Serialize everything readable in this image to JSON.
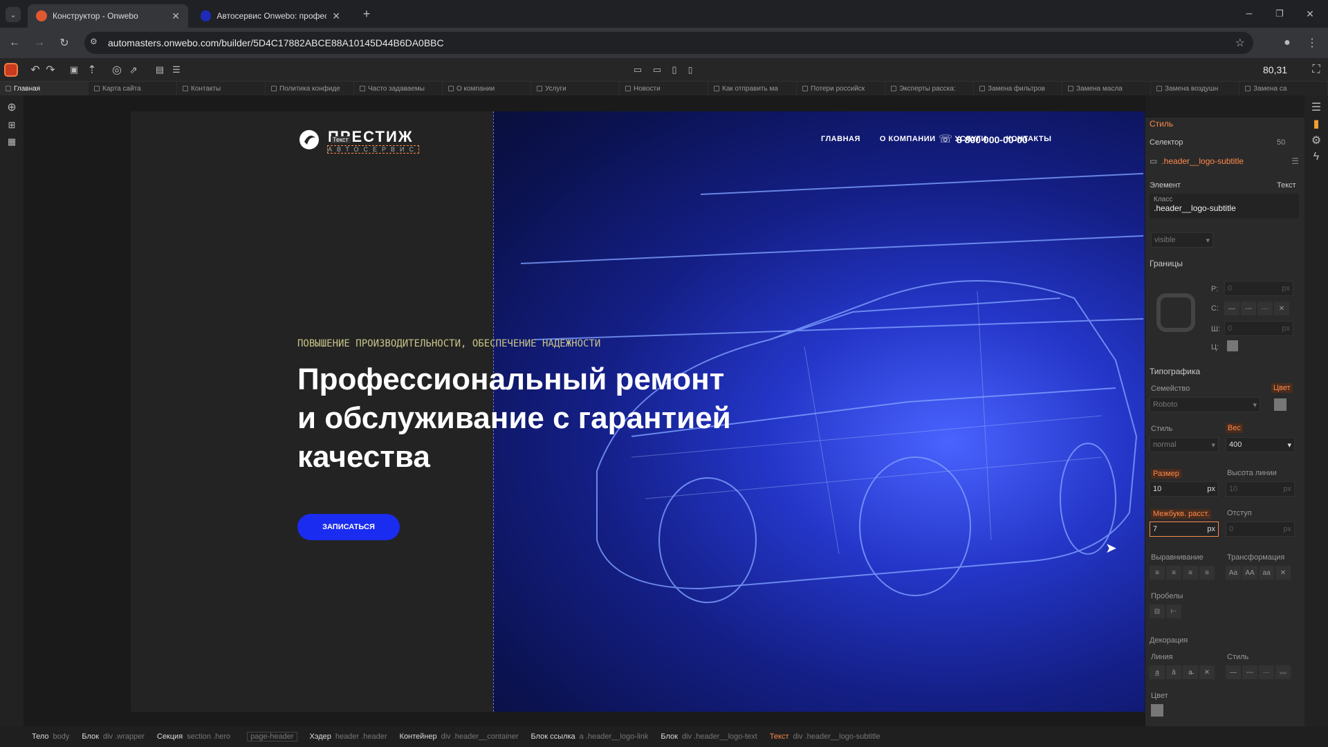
{
  "browser": {
    "tabs": [
      {
        "title": "Конструктор - Onwebo",
        "active": true
      },
      {
        "title": "Автосервис Onwebo: професс",
        "active": false
      }
    ],
    "url": "automasters.onwebo.com/builder/5D4C17882ABCE88A10145D44B6DA0BBC"
  },
  "editor": {
    "zoom": "80,31",
    "page_tabs": [
      "Главная",
      "Карта сайта",
      "Контакты",
      "Политика конфиде",
      "Часто задаваемы",
      "О компании",
      "Услуги",
      "Новости",
      "Как отправить ма",
      "Потери российск",
      "Эксперты расска:",
      "Замена фильтров",
      "Замена масла",
      "Замена воздушн",
      "Замена са"
    ]
  },
  "site": {
    "logo_title": "ПРЕСТИЖ",
    "logo_subtitle": "АВТОСЕРВИС",
    "logo_badge": "Текст",
    "nav": [
      "ГЛАВНАЯ",
      "О КОМПАНИИ",
      "УСЛУГИ",
      "КОНТАКТЫ"
    ],
    "phone": "8 800 000-00-00",
    "tagline": "ПОВЫШЕНИЕ ПРОИЗВОДИТЕЛЬНОСТИ, ОБЕСПЕЧЕНИЕ НАДЕЖНОСТИ",
    "headline_1": "Профессиональный ремонт",
    "headline_2": "и обслуживание с гарантией",
    "headline_3": "качества",
    "cta": "ЗАПИСАТЬСЯ"
  },
  "panel": {
    "title": "Стиль",
    "selector_label": "Селектор",
    "selector_count": "50",
    "selector_value": ".header__logo-subtitle",
    "element_label": "Элемент",
    "element_type": "Текст",
    "class_label": "Класс",
    "class_value": ".header__logo-subtitle",
    "overflow_value": "visible",
    "borders_title": "Границы",
    "border_r": "Р:",
    "border_c": "С:",
    "border_w": "Ш:",
    "border_col": "Ц:",
    "border_r_val": "0",
    "border_w_val": "0",
    "unit_px": "px",
    "typo_title": "Типографика",
    "family_label": "Семейство",
    "color_label": "Цвет",
    "family_value": "Roboto",
    "style_label": "Стиль",
    "weight_label": "Вес",
    "style_value": "normal",
    "weight_value": "400",
    "size_label": "Размер",
    "lineheight_label": "Высота линии",
    "size_value": "10",
    "lineheight_value": "10",
    "letter_label": "Межбукв. расст.",
    "indent_label": "Отступ",
    "letter_value": "7",
    "indent_value": "0",
    "align_label": "Выравнивание",
    "transform_label": "Трансформация",
    "transform_opts": [
      "Aa",
      "AA",
      "aa"
    ],
    "spaces_label": "Пробелы",
    "decor_title": "Декорация",
    "line_label": "Линия",
    "decor_style_label": "Стиль",
    "decor_color_label": "Цвет"
  },
  "breadcrumbs": [
    {
      "name": "Тело",
      "tag": "body"
    },
    {
      "name": "Блок",
      "tag": "div .wrapper"
    },
    {
      "name": "Секция",
      "tag": "section .hero"
    },
    {
      "name": "",
      "tag": "page-header"
    },
    {
      "name": "Хэдер",
      "tag": "header .header"
    },
    {
      "name": "Контейнер",
      "tag": "div .header__container"
    },
    {
      "name": "Блок ссылка",
      "tag": "a .header__logo-link"
    },
    {
      "name": "Блок",
      "tag": "div .header__logo-text"
    },
    {
      "name": "Текст",
      "tag": "div .header__logo-subtitle"
    }
  ],
  "colors": {
    "accent": "#ff8a4c",
    "cta": "#1a2cf0",
    "tagline": "#c9c48a"
  }
}
